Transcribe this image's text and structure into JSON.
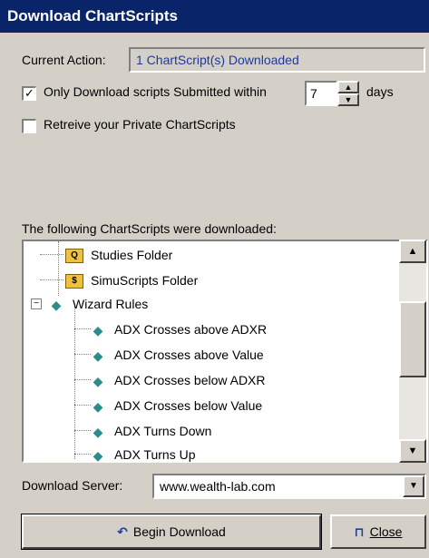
{
  "window": {
    "title": "Download ChartScripts"
  },
  "current_action": {
    "label": "Current Action:",
    "value": "1 ChartScript(s) Downloaded"
  },
  "options": {
    "only_download": {
      "label": "Only Download scripts Submitted within",
      "checked": true,
      "check_glyph": "✓"
    },
    "days_value": "7",
    "days_label": "days",
    "private": {
      "label": "Retreive your Private ChartScripts",
      "checked": false
    }
  },
  "tree": {
    "caption": "The following ChartScripts were downloaded:",
    "items": [
      {
        "label": "Studies Folder",
        "icon": "studies-folder-icon",
        "glyph": "Q"
      },
      {
        "label": "SimuScripts Folder",
        "icon": "simuscripts-folder-icon",
        "glyph": "$"
      },
      {
        "label": "Wizard Rules",
        "icon": "wizard-rules-icon",
        "glyph": "◆",
        "expander": "−"
      },
      {
        "label": "ADX Crosses above ADXR",
        "icon": "rule-icon",
        "glyph": "◆"
      },
      {
        "label": "ADX Crosses above Value",
        "icon": "rule-icon",
        "glyph": "◆"
      },
      {
        "label": "ADX Crosses below ADXR",
        "icon": "rule-icon",
        "glyph": "◆"
      },
      {
        "label": "ADX Crosses below Value",
        "icon": "rule-icon",
        "glyph": "◆"
      },
      {
        "label": "ADX Turns Down",
        "icon": "rule-icon",
        "glyph": "◆"
      },
      {
        "label": "ADX Turns Up",
        "icon": "rule-icon",
        "glyph": "◆"
      }
    ],
    "scroll_up": "▲",
    "scroll_down": "▼"
  },
  "server": {
    "label": "Download Server:",
    "value": "www.wealth-lab.com",
    "dropdown_glyph": "▼"
  },
  "buttons": {
    "begin": {
      "label": "Begin Download",
      "icon": "download-arrow-icon",
      "glyph": "↶"
    },
    "close": {
      "label": "Close",
      "icon": "door-icon",
      "glyph": "⊓"
    }
  },
  "spin": {
    "up": "▲",
    "down": "▼"
  }
}
